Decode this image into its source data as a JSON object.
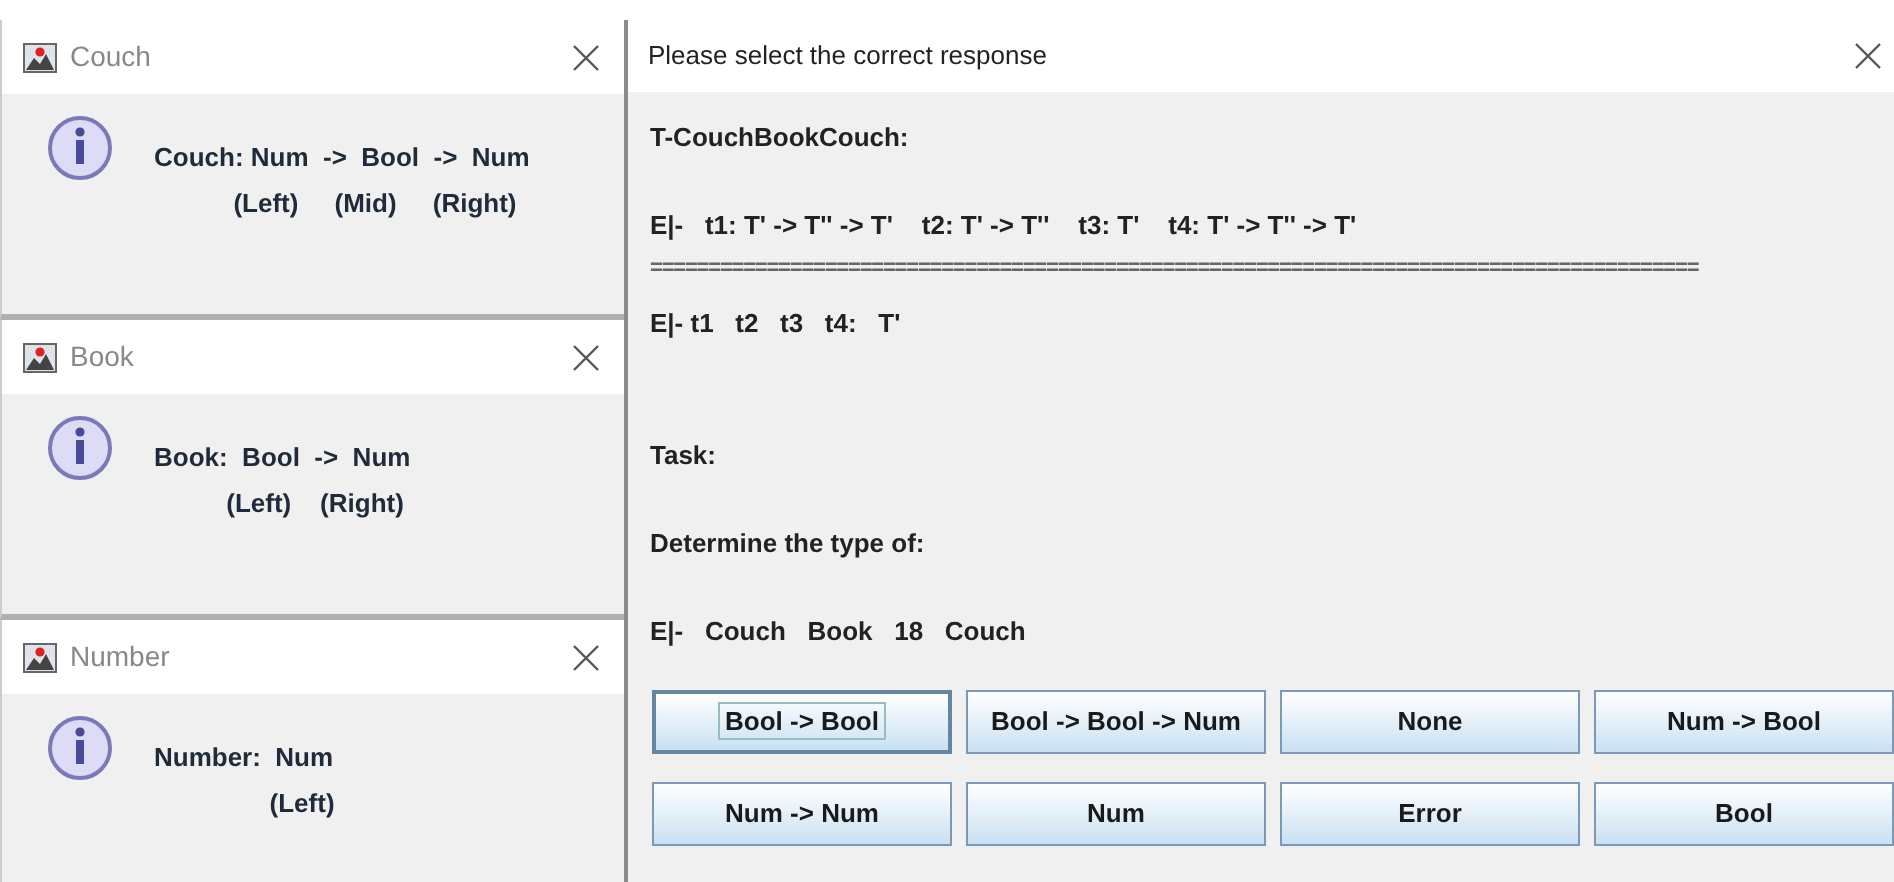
{
  "info_dialogs": [
    {
      "title": "Couch",
      "lines": [
        "Couch: Num  ->  Bool  ->  Num",
        "           (Left)     (Mid)     (Right)"
      ]
    },
    {
      "title": "Book",
      "lines": [
        "Book:  Bool  ->  Num",
        "          (Left)    (Right)"
      ]
    },
    {
      "title": "Number",
      "lines": [
        "Number:  Num",
        "                (Left)"
      ]
    }
  ],
  "question_dialog": {
    "title": "Please select the correct response",
    "lines": [
      {
        "kind": "text",
        "text": "T-CouchBookCouch:"
      },
      {
        "kind": "text",
        "text": "E|-   t1: T' -> T'' -> T'    t2: T' -> T''    t3: T'    t4: T' -> T'' -> T'"
      },
      {
        "kind": "rule",
        "text": "=========================================================================================="
      },
      {
        "kind": "text",
        "text": "E|- t1   t2   t3   t4:   T'"
      },
      {
        "kind": "gap"
      },
      {
        "kind": "text",
        "text": "Task:"
      },
      {
        "kind": "text",
        "text": "Determine the type of:"
      },
      {
        "kind": "text",
        "text": "E|-   Couch   Book   18   Couch"
      }
    ],
    "answers": [
      {
        "label": "Bool -> Bool",
        "selected": true
      },
      {
        "label": "Bool -> Bool -> Num",
        "selected": false
      },
      {
        "label": "None",
        "selected": false
      },
      {
        "label": "Num -> Bool",
        "selected": false
      },
      {
        "label": "Num -> Num",
        "selected": false
      },
      {
        "label": "Num",
        "selected": false
      },
      {
        "label": "Error",
        "selected": false
      },
      {
        "label": "Bool",
        "selected": false
      }
    ]
  }
}
